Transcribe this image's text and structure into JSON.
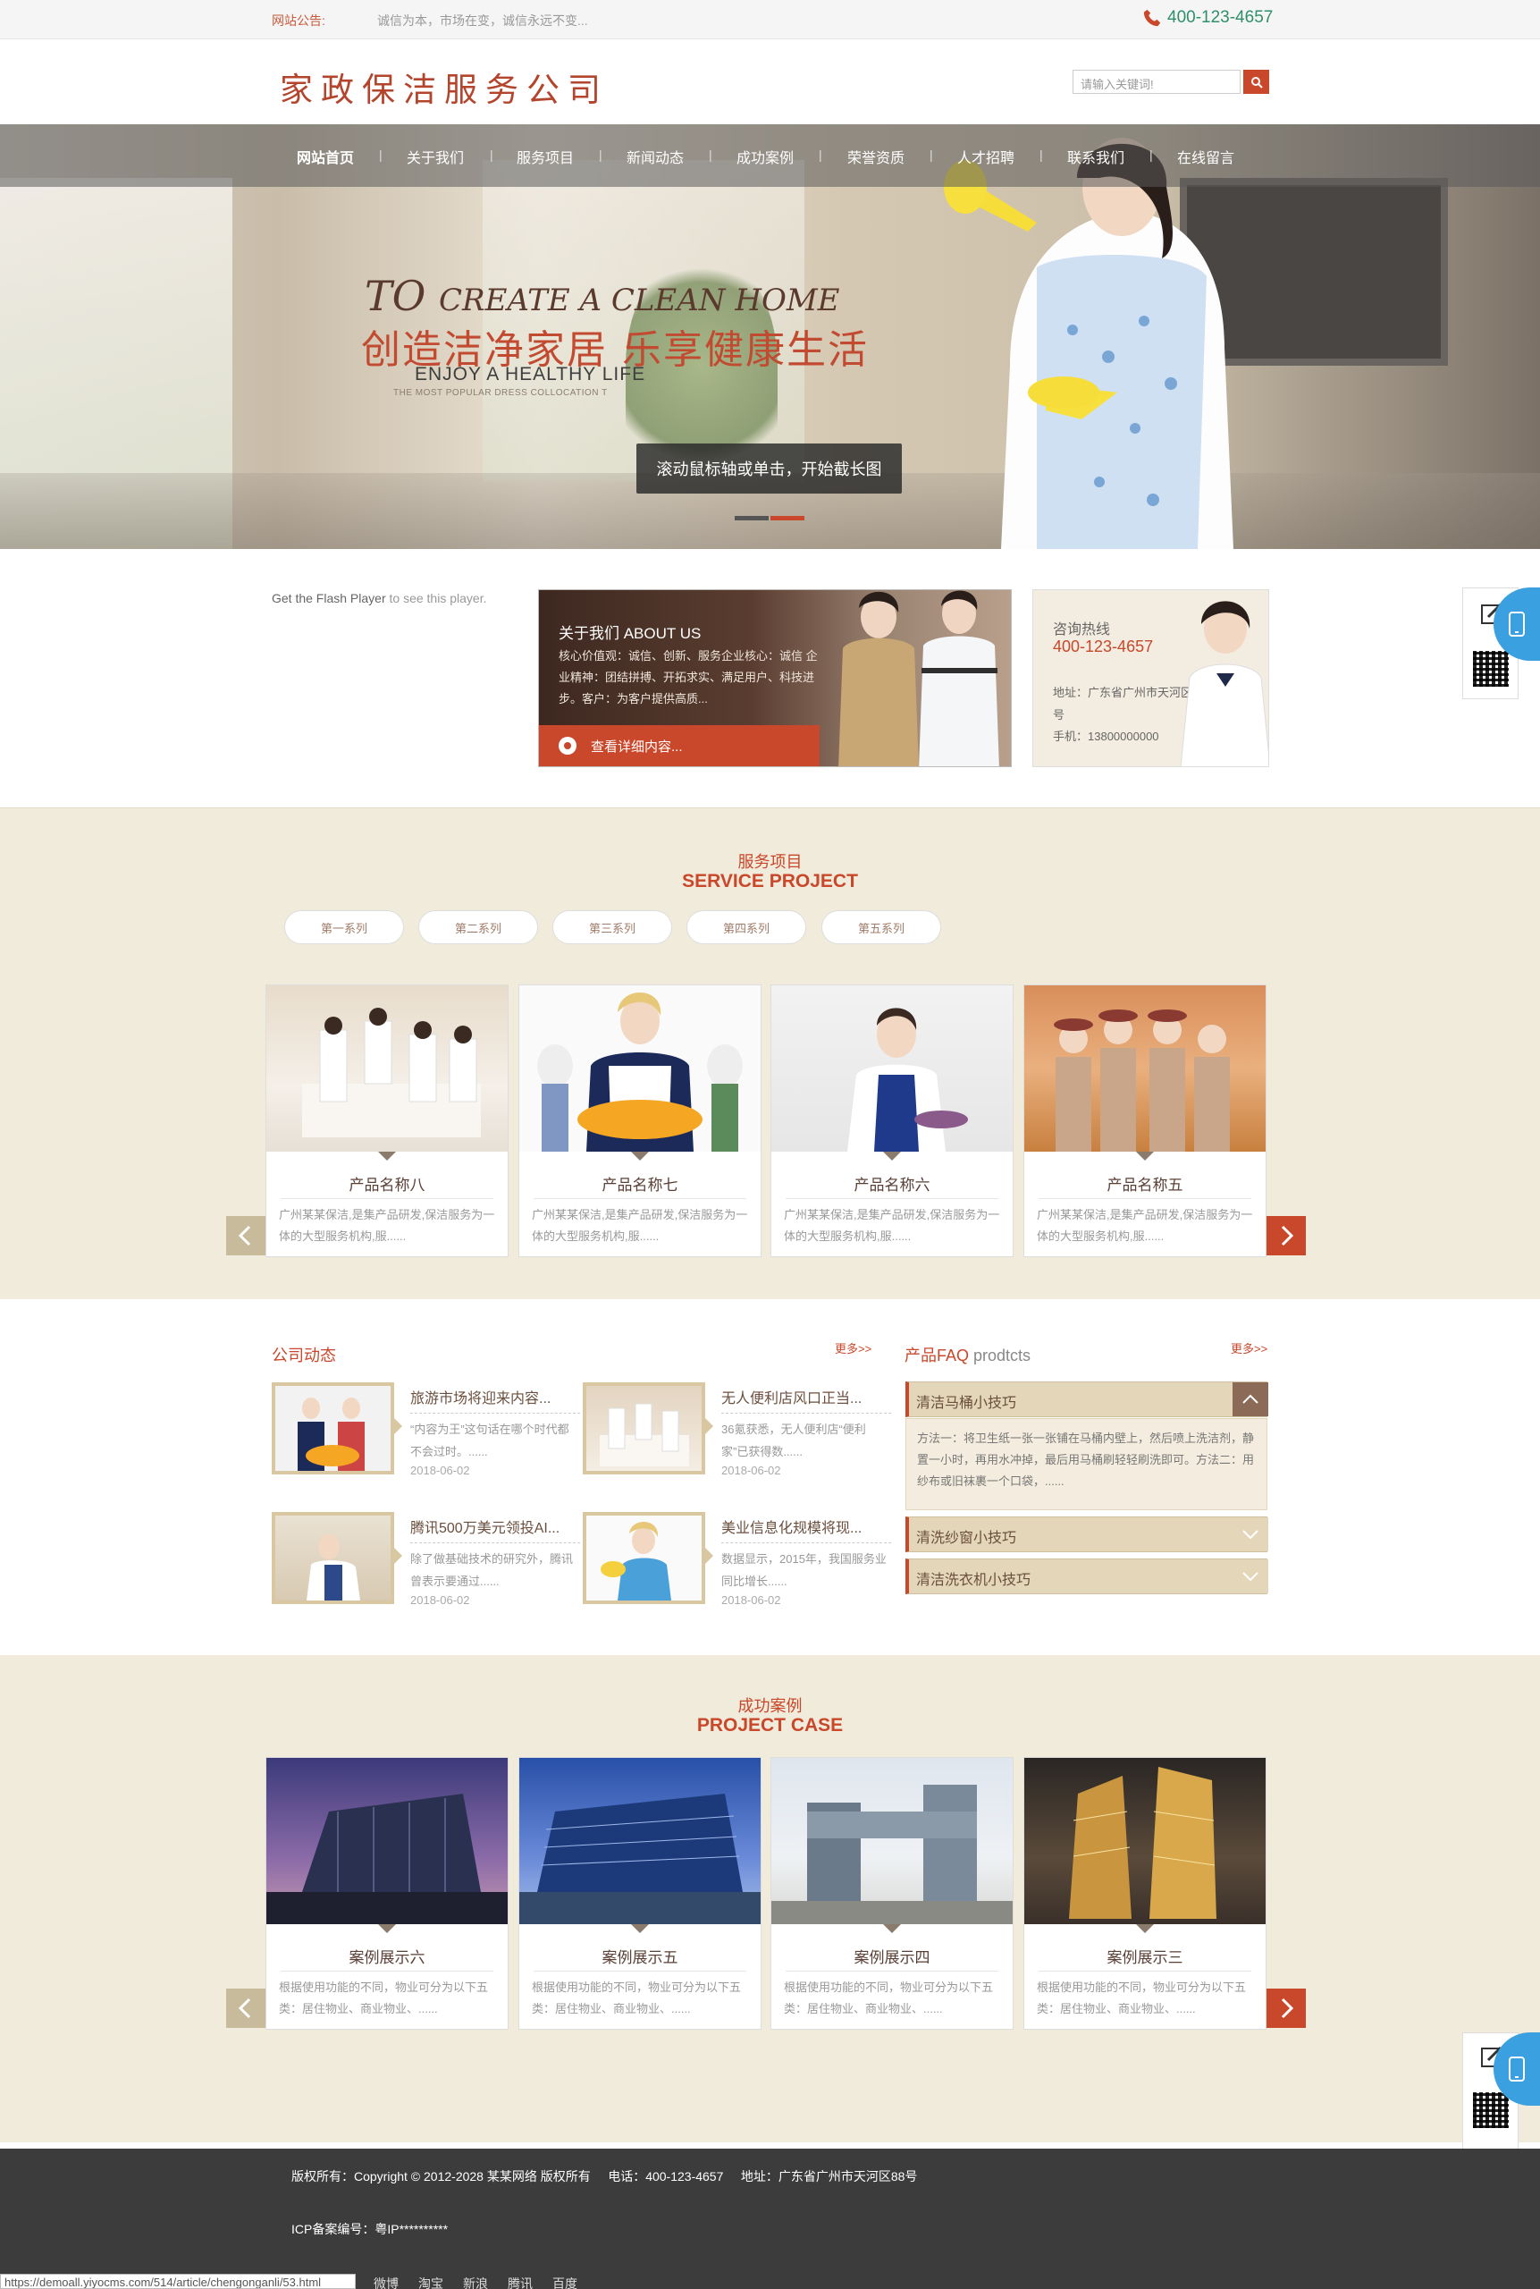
{
  "topbar": {
    "notice_label": "网站公告:",
    "notice_text": "诚信为本，市场在变，诚信永远不变...",
    "phone": "400-123-4657"
  },
  "header": {
    "logo": "家政保洁服务公司",
    "search_placeholder": "请输入关键词!"
  },
  "nav": [
    "网站首页",
    "关于我们",
    "服务项目",
    "新闻动态",
    "成功案例",
    "荣誉资质",
    "人才招聘",
    "联系我们",
    "在线留言"
  ],
  "banner": {
    "line1_big": "TO",
    "line1_rest": "CREATE A CLEAN HOME",
    "line2": "创造洁净家居 乐享健康生活",
    "line3": "ENJOY A HEALTHY LIFE",
    "line4": "THE MOST POPULAR DRESS COLLOCATION T",
    "tooltip": "滚动鼠标轴或单击，开始截长图",
    "active_slide": 2,
    "accent": "#c9472b"
  },
  "intro": {
    "flash_link": "Get the Flash Player",
    "flash_rest": "to see this player.",
    "about_title": "关于我们 ABOUT US",
    "about_text": "核心价值观：诚信、创新、服务企业核心：诚信 企业精神：团结拼搏、开拓求实、满足用户、科技进步。客户：为客户提供高质...",
    "about_more": "查看详细内容...",
    "hotline_label": "咨询热线",
    "hotline_number": "400-123-4657",
    "address": "地址：广东省广州市天河区88号",
    "mobile": "手机：13800000000"
  },
  "services": {
    "title_cn": "服务项目",
    "title_en": "SERVICE PROJECT",
    "tabs": [
      "第一系列",
      "第二系列",
      "第三系列",
      "第四系列",
      "第五系列"
    ],
    "items": [
      {
        "name": "产品名称八",
        "desc": "广州某某保洁,是集产品研发,保洁服务为一体的大型服务机构,服......"
      },
      {
        "name": "产品名称七",
        "desc": "广州某某保洁,是集产品研发,保洁服务为一体的大型服务机构,服......"
      },
      {
        "name": "产品名称六",
        "desc": "广州某某保洁,是集产品研发,保洁服务为一体的大型服务机构,服......"
      },
      {
        "name": "产品名称五",
        "desc": "广州某某保洁,是集产品研发,保洁服务为一体的大型服务机构,服......"
      }
    ]
  },
  "news": {
    "title": "公司动态",
    "more": "更多>>",
    "items": [
      {
        "title": "旅游市场将迎来内容...",
        "desc": "“内容为王”这句话在哪个时代都不会过时。......",
        "date": "2018-06-02"
      },
      {
        "title": "无人便利店风口正当...",
        "desc": "36氪获悉，无人便利店“便利家”已获得数......",
        "date": "2018-06-02"
      },
      {
        "title": "腾讯500万美元领投AI...",
        "desc": "除了做基础技术的研究外，腾讯曾表示要通过......",
        "date": "2018-06-02"
      },
      {
        "title": "美业信息化规模将现...",
        "desc": "数据显示，2015年，我国服务业同比增长......",
        "date": "2018-06-02"
      }
    ]
  },
  "faq": {
    "title": "产品FAQ",
    "title_en": "prodtcts",
    "more": "更多>>",
    "items": [
      {
        "q": "清洁马桶小技巧",
        "a": "方法一：将卫生纸一张一张铺在马桶内壁上，然后喷上洗洁剂，静置一小时，再用水冲掉，最后用马桶刷轻轻刷洗即可。方法二：用纱布或旧袜裹一个口袋，......"
      },
      {
        "q": "清洗纱窗小技巧"
      },
      {
        "q": "清洁洗衣机小技巧"
      }
    ]
  },
  "cases": {
    "title_cn": "成功案例",
    "title_en": "PROJECT CASE",
    "items": [
      {
        "name": "案例展示六",
        "desc": "根据使用功能的不同，物业可分为以下五类：居住物业、商业物业、......"
      },
      {
        "name": "案例展示五",
        "desc": "根据使用功能的不同，物业可分为以下五类：居住物业、商业物业、......"
      },
      {
        "name": "案例展示四",
        "desc": "根据使用功能的不同，物业可分为以下五类：居住物业、商业物业、......"
      },
      {
        "name": "案例展示三",
        "desc": "根据使用功能的不同，物业可分为以下五类：居住物业、商业物业、......"
      }
    ]
  },
  "footer": {
    "copyright": "版权所有：Copyright © 2012-2028 某某网络 版权所有     电话：400-123-4657     地址：广东省广州市天河区88号",
    "icp": "ICP备案编号：粤IP**********",
    "status_url": "https://demoall.yiyocms.com/514/article/chengonganli/53.html",
    "links": [
      "微博",
      "淘宝",
      "新浪",
      "腾讯",
      "百度"
    ]
  }
}
